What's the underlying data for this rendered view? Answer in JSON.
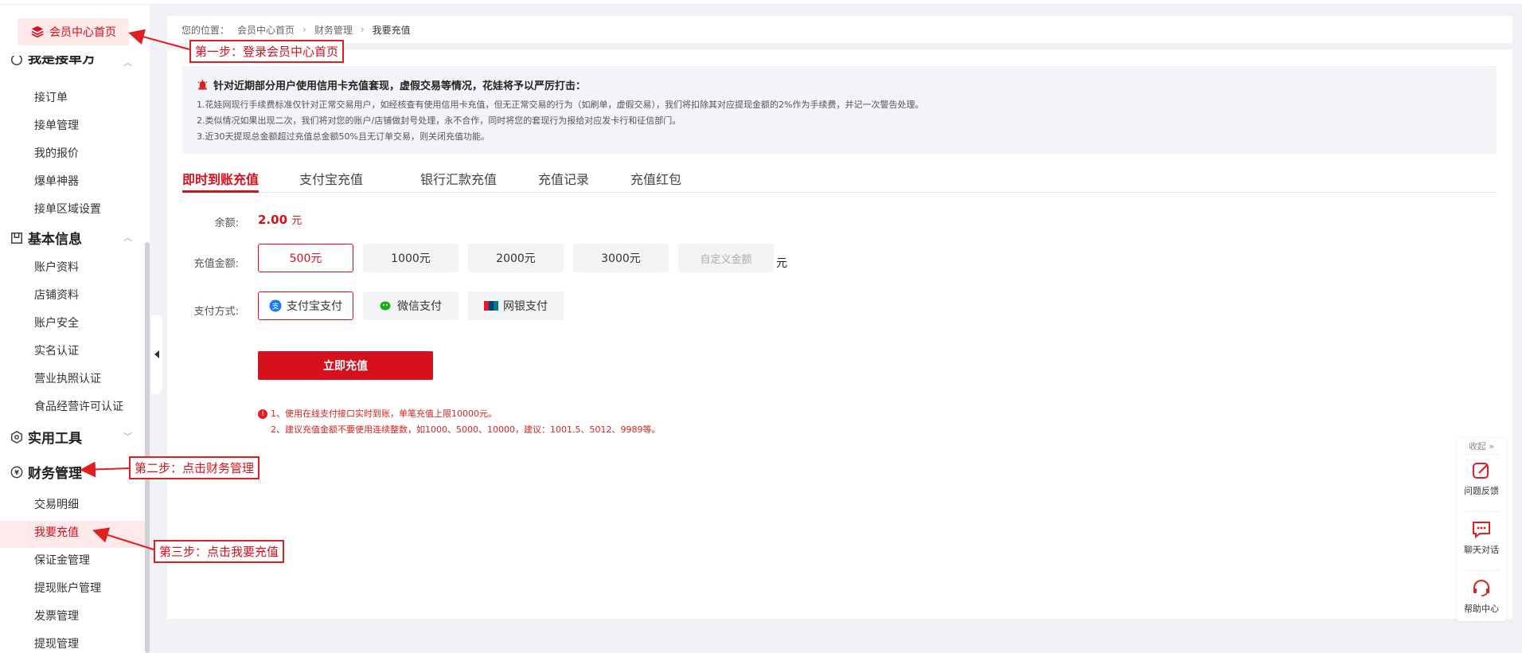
{
  "sidebar": {
    "home_label": "会员中心首页",
    "partial_section_label": "我是接单方",
    "sections": [
      {
        "label": "基本信息"
      },
      {
        "label": "实用工具"
      },
      {
        "label": "财务管理"
      }
    ],
    "group1_items": [
      "接订单",
      "接单管理",
      "我的报价",
      "爆单神器",
      "接单区域设置"
    ],
    "group2_items": [
      "账户资料",
      "店铺资料",
      "账户安全",
      "实名认证",
      "营业执照认证",
      "食品经营许可认证"
    ],
    "group3_items": [
      "交易明细",
      "我要充值",
      "保证金管理",
      "提现账户管理",
      "发票管理",
      "提现管理"
    ]
  },
  "breadcrumb": {
    "prefix": "您的位置：",
    "items": [
      "会员中心首页",
      "财务管理",
      "我要充值"
    ]
  },
  "notice": {
    "title": "针对近期部分用户使用信用卡充值套现，虚假交易等情况，花娃将予以严厉打击：",
    "lines": [
      "1.花娃网现行手续费标准仅针对正常交易用户，如经核查有使用信用卡充值，但无正常交易的行为（如刷单，虚假交易），我们将扣除其对应提现金额的2%作为手续费，并记一次警告处理。",
      "2.类似情况如果出现二次，我们将对您的账户/店铺做封号处理，永不合作，同时将您的套现行为报给对应发卡行和征信部门。",
      "3.近30天提现总金额超过充值总金额50%且无订单交易，则关闭充值功能。"
    ]
  },
  "tabs": [
    "即时到账充值",
    "支付宝充值",
    "银行汇款充值",
    "充值记录",
    "充值红包"
  ],
  "form": {
    "balance_label": "余额:",
    "balance_value": "2.00",
    "balance_unit": "元",
    "amount_label": "充值金额:",
    "amounts": [
      "500元",
      "1000元",
      "2000元",
      "3000元"
    ],
    "custom_placeholder": "自定义金额",
    "amount_unit": "元",
    "pay_label": "支付方式:",
    "pay_methods": [
      "支付宝支付",
      "微信支付",
      "网银支付"
    ],
    "submit_label": "立即充值",
    "tips": [
      "1、使用在线支付接口实时到账，单笔充值上限10000元。",
      "2、建议充值金额不要使用连续整数，如1000、5000、10000，建议：1001.5、5012、9989等。"
    ]
  },
  "annotations": {
    "step1": "第一步：登录会员中心首页",
    "step2": "第二步：点击财务管理",
    "step3": "第三步：点击我要充值"
  },
  "float_tools": {
    "fold": "收起 »",
    "items": [
      "问题反馈",
      "聊天对话",
      "帮助中心"
    ]
  },
  "colors": {
    "accent": "#d7101e",
    "accent_bg": "#fde8ea",
    "annotation": "#e02020"
  }
}
